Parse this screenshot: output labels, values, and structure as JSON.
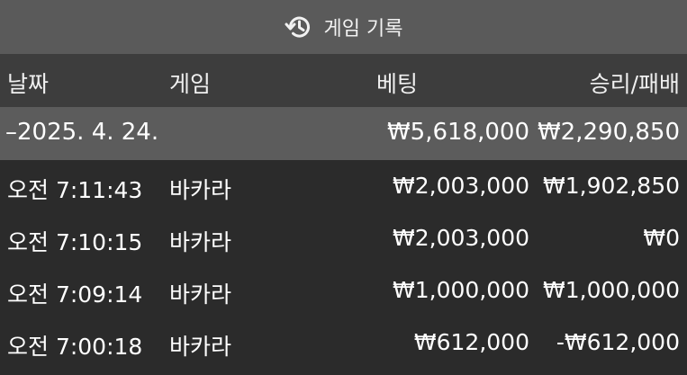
{
  "header": {
    "title": "게임 기록",
    "icon": "history-icon"
  },
  "columns": {
    "date": "날짜",
    "game": "게임",
    "bet": "베팅",
    "result": "승리/패배"
  },
  "group": {
    "date": "–2025. 4. 24.",
    "total_bet": "₩5,618,000",
    "total_result": "₩2,290,850"
  },
  "rows": [
    {
      "time": "오전 7:11:43",
      "game": "바카라",
      "bet": "₩2,003,000",
      "result": "₩1,902,850"
    },
    {
      "time": "오전 7:10:15",
      "game": "바카라",
      "bet": "₩2,003,000",
      "result": "₩0"
    },
    {
      "time": "오전 7:09:14",
      "game": "바카라",
      "bet": "₩1,000,000",
      "result": "₩1,000,000"
    },
    {
      "time": "오전 7:00:18",
      "game": "바카라",
      "bet": "₩612,000",
      "result": "-₩612,000"
    }
  ],
  "colors": {
    "header_bg": "#5a5a5a",
    "column_header_bg": "#3d3d3d",
    "group_row_bg": "#5c5c5c",
    "body_bg": "#2b2b2b"
  }
}
